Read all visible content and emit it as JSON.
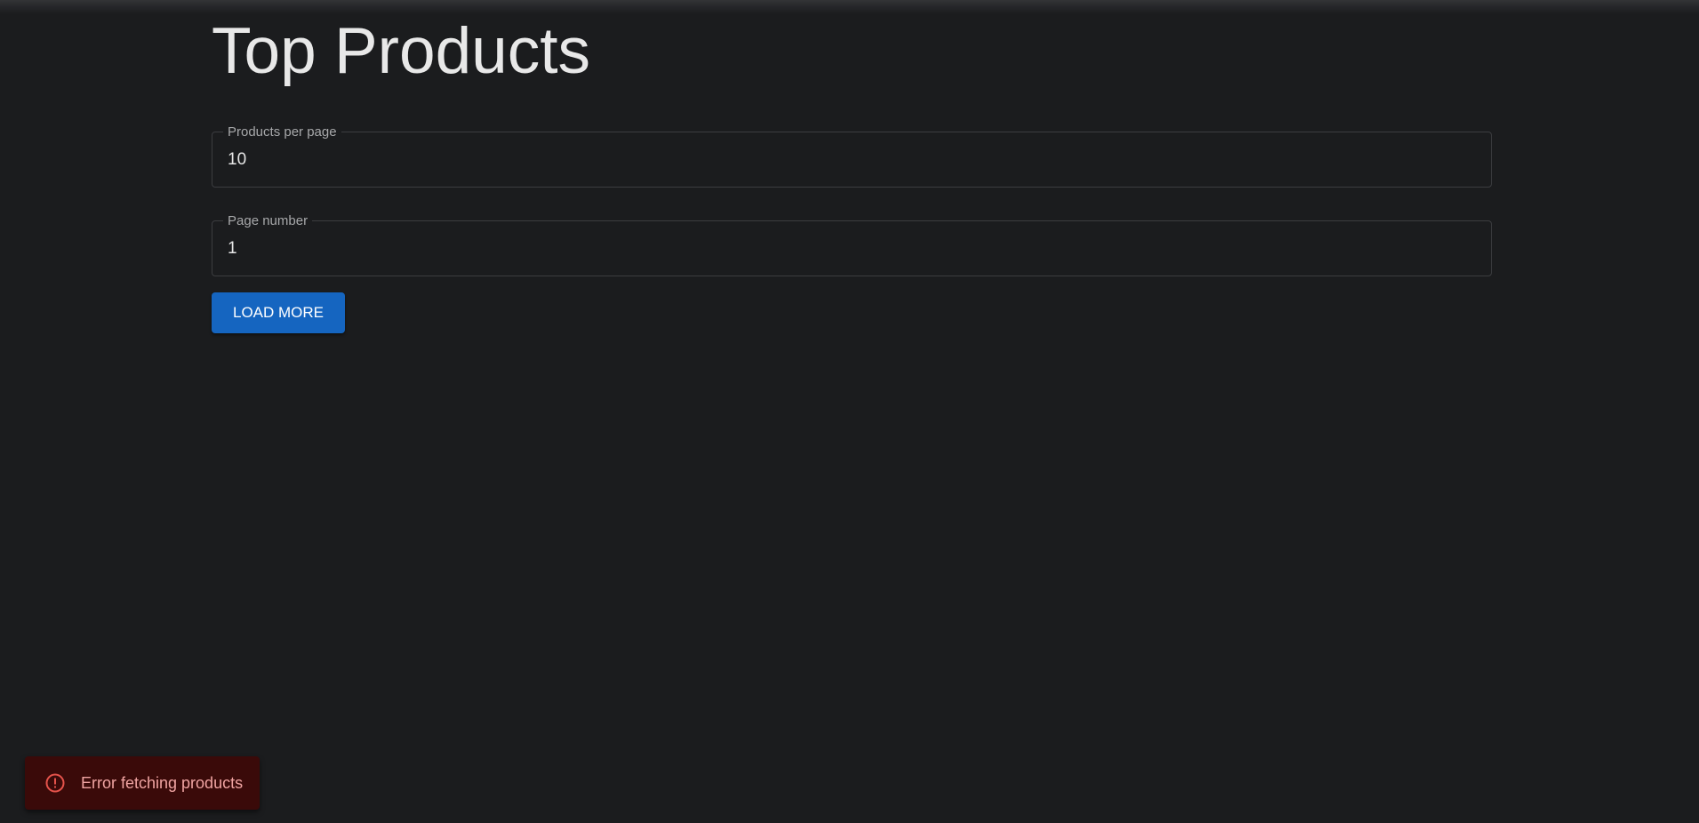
{
  "page": {
    "title": "Top Products"
  },
  "form": {
    "per_page": {
      "label": "Products per page",
      "value": "10"
    },
    "page_number": {
      "label": "Page number",
      "value": "1"
    },
    "load_more_label": "LOAD MORE"
  },
  "toast": {
    "severity": "error",
    "icon": "error-outline-icon",
    "message": "Error fetching products"
  },
  "colors": {
    "background": "#1b1c1e",
    "primary": "#1565c0",
    "error_bg": "#3a0a09",
    "error_text": "#f0a4a2",
    "error_icon": "#e5534b"
  }
}
